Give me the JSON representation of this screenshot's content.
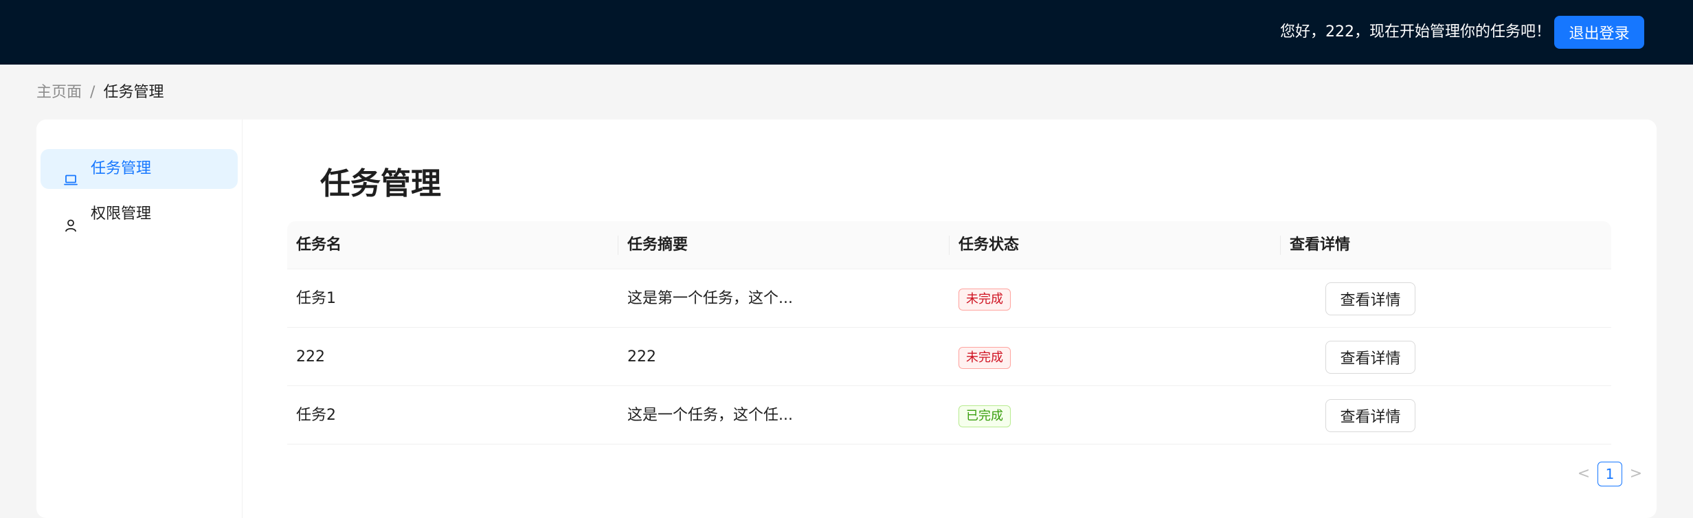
{
  "header": {
    "greeting": "您好，222，现在开始管理你的任务吧！",
    "logout_label": "退出登录"
  },
  "breadcrumb": {
    "home": "主页面",
    "separator": "/",
    "current": "任务管理"
  },
  "sidebar": {
    "items": [
      {
        "label": "任务管理",
        "icon": "laptop-icon",
        "active": true
      },
      {
        "label": "权限管理",
        "icon": "user-icon",
        "active": false
      }
    ]
  },
  "main": {
    "title": "任务管理",
    "columns": [
      "任务名",
      "任务摘要",
      "任务状态",
      "查看详情"
    ],
    "rows": [
      {
        "name": "任务1",
        "summary": "这是第一个任务，这个...",
        "status": "未完成",
        "action": "查看详情"
      },
      {
        "name": "222",
        "summary": "222",
        "status": "未完成",
        "action": "查看详情"
      },
      {
        "name": "任务2",
        "summary": "这是一个任务，这个任...",
        "status": "已完成",
        "action": "查看详情"
      }
    ],
    "pagination": {
      "prev": "<",
      "page": "1",
      "next": ">"
    }
  },
  "colors": {
    "header_bg": "#001529",
    "primary": "#1677ff",
    "status_incomplete": "#cf1322",
    "status_complete": "#389e0d"
  }
}
